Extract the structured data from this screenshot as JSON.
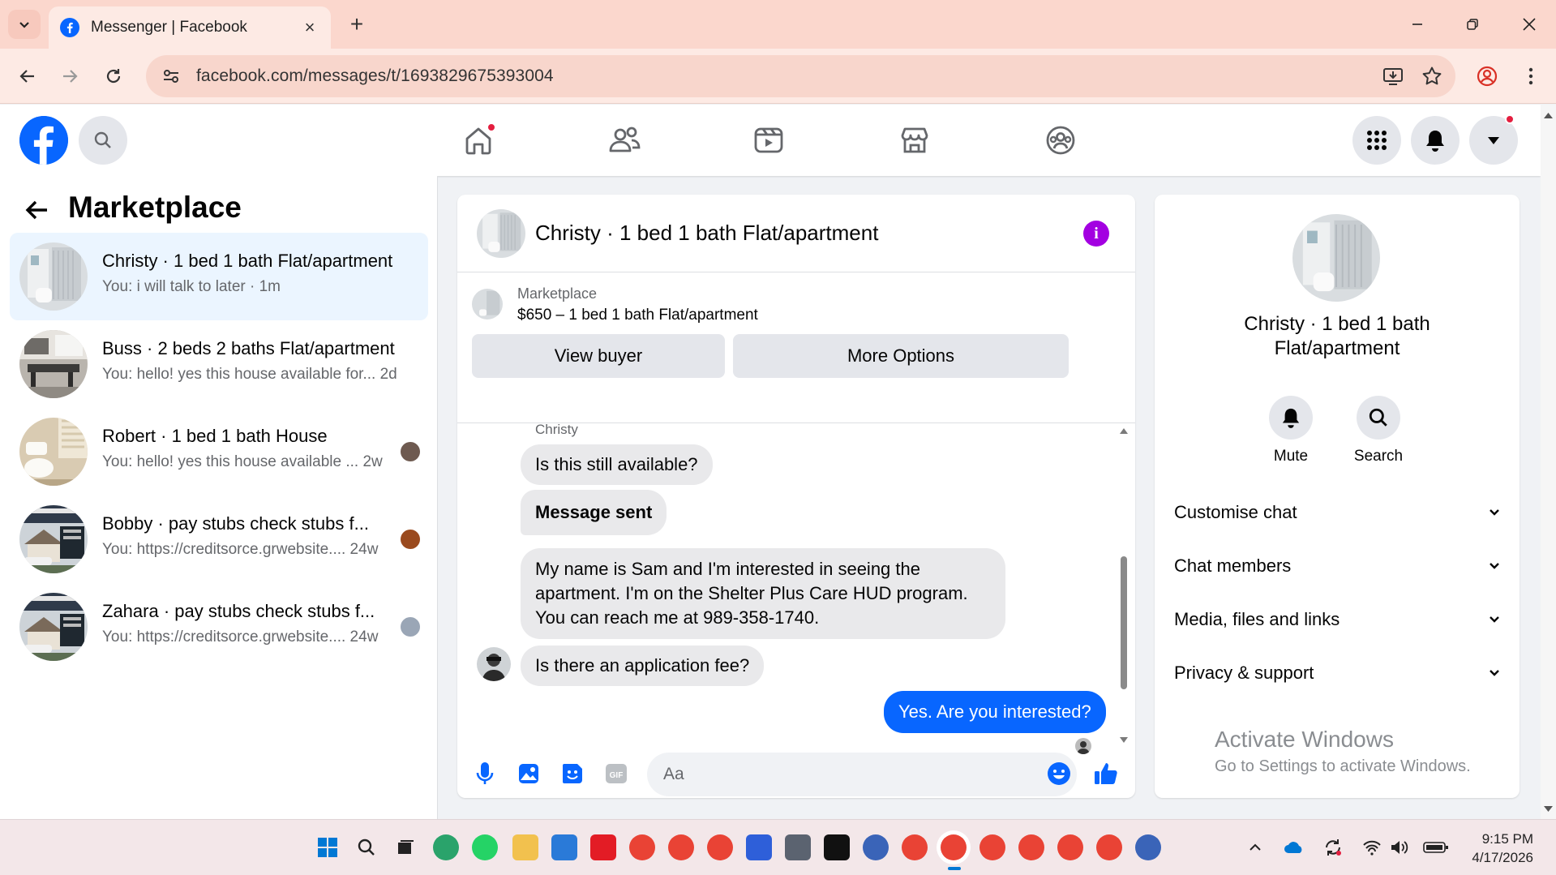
{
  "browser": {
    "tab_title": "Messenger | Facebook",
    "url": "facebook.com/messages/t/1693829675393004"
  },
  "sidebar": {
    "title": "Marketplace",
    "conversations": [
      {
        "name": "Christy · 1 bed 1 bath Flat/apartment",
        "preview": "You: i will talk to later · 1m",
        "active": true
      },
      {
        "name": "Buss · 2 beds 2 baths Flat/apartment",
        "preview": "You: hello! yes this house available for...  2d",
        "active": false
      },
      {
        "name": "Robert · 1 bed 1 bath House",
        "preview": "You: hello! yes this house available ...  2w",
        "active": false
      },
      {
        "name": "Bobby · pay stubs check stubs f...",
        "preview": "You: https://creditsorce.grwebsite....  24w",
        "active": false
      },
      {
        "name": "Zahara · pay stubs check stubs f...",
        "preview": "You: https://creditsorce.grwebsite....  24w",
        "active": false
      }
    ]
  },
  "chat": {
    "title": "Christy · 1 bed 1 bath Flat/apartment",
    "listing_source": "Marketplace",
    "listing_title": "$650 – 1 bed 1 bath Flat/apartment",
    "view_buyer_label": "View buyer",
    "more_options_label": "More Options",
    "sender_label": "Christy",
    "messages": [
      {
        "text": "Is this still available?",
        "direction": "in"
      },
      {
        "text": "Message sent",
        "direction": "in"
      },
      {
        "text_lines": [
          "My name is Sam and I'm interested in seeing the",
          "apartment. I'm on the Shelter Plus Care HUD program.",
          "You can reach me at 989-358-1740."
        ],
        "direction": "in"
      },
      {
        "text": "Is there an application fee?",
        "direction": "in"
      },
      {
        "text": "Yes. Are you interested?",
        "direction": "out"
      }
    ],
    "input_placeholder": "Aa"
  },
  "info_panel": {
    "name_line1": "Christy · 1 bed 1 bath",
    "name_line2": "Flat/apartment",
    "mute_label": "Mute",
    "search_label": "Search",
    "sections": [
      "Customise chat",
      "Chat members",
      "Media, files and links",
      "Privacy & support"
    ],
    "watermark_line1": "Activate Windows",
    "watermark_line2": "Go to Settings to activate Windows."
  },
  "taskbar": {
    "time": "9:15 PM",
    "date": "4/17/2026"
  },
  "colors": {
    "fb_blue": "#0866ff",
    "notification_red": "#e41e3f",
    "info_purple": "#a300e1",
    "active_row": "#ebf5ff"
  }
}
